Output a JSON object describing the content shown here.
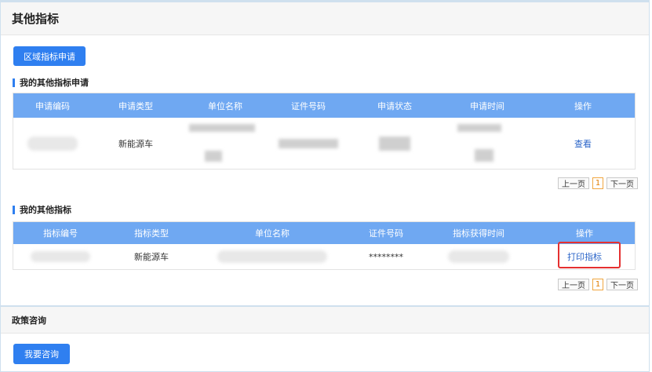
{
  "other_indicators": {
    "title": "其他指标",
    "region_apply_button": "区域指标申请"
  },
  "applications": {
    "section_title": "我的其他指标申请",
    "columns": [
      "申请编码",
      "申请类型",
      "单位名称",
      "证件号码",
      "申请状态",
      "申请时间",
      "操作"
    ],
    "rows": [
      {
        "type": "新能源车",
        "action": "查看"
      }
    ],
    "pager": {
      "prev": "上一页",
      "current": "1",
      "next": "下一页"
    }
  },
  "indicators": {
    "section_title": "我的其他指标",
    "columns": [
      "指标编号",
      "指标类型",
      "单位名称",
      "证件号码",
      "指标获得时间",
      "操作"
    ],
    "rows": [
      {
        "type": "新能源车",
        "cert": "********",
        "action": "打印指标"
      }
    ],
    "pager": {
      "prev": "上一页",
      "current": "1",
      "next": "下一页"
    }
  },
  "policy": {
    "title": "政策咨询",
    "consult_button": "我要咨询"
  },
  "colors": {
    "primary": "#2f7ff0",
    "table_header": "#6fa8f2",
    "highlight": "#e53030"
  }
}
